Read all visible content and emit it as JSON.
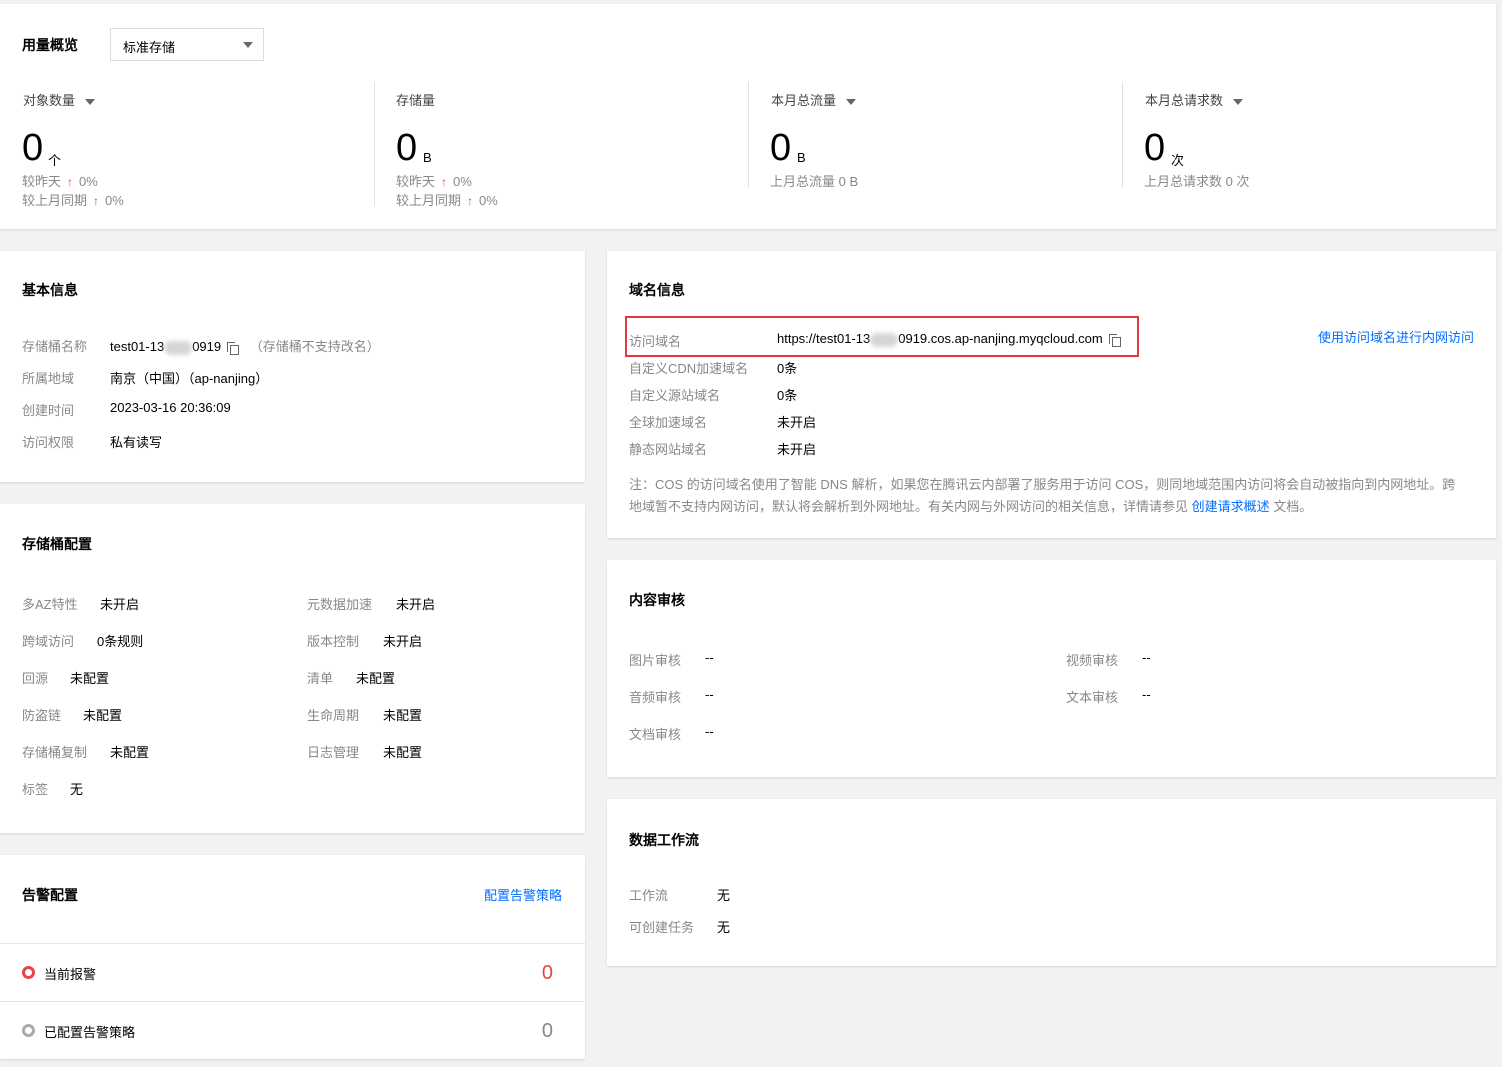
{
  "overview": {
    "title": "用量概览",
    "select_value": "标准存储",
    "stats": [
      {
        "label": "对象数量",
        "value": "0",
        "unit": "个",
        "dropdown": true,
        "lines": [
          {
            "text": "较昨天",
            "pct": "0%"
          },
          {
            "text": "较上月同期",
            "pct": "0%"
          }
        ]
      },
      {
        "label": "存储量",
        "value": "0",
        "unit": "B",
        "dropdown": false,
        "lines": [
          {
            "text": "较昨天",
            "pct": "0%"
          },
          {
            "text": "较上月同期",
            "pct": "0%"
          }
        ]
      },
      {
        "label": "本月总流量",
        "value": "0",
        "unit": "B",
        "dropdown": true,
        "sub": "上月总流量 0 B"
      },
      {
        "label": "本月总请求数",
        "value": "0",
        "unit": "次",
        "dropdown": true,
        "sub": "上月总请求数 0 次"
      }
    ],
    "up_arrow": "↑"
  },
  "basic": {
    "title": "基本信息",
    "name_label": "存储桶名称",
    "name_prefix": "test01-13",
    "name_suffix": "0919",
    "name_note": "（存储桶不支持改名）",
    "region_label": "所属地域",
    "region_value": "南京（中国）（ap-nanjing）",
    "created_label": "创建时间",
    "created_value": "2023-03-16 20:36:09",
    "acl_label": "访问权限",
    "acl_value": "私有读写"
  },
  "bucket_config": {
    "title": "存储桶配置",
    "left": [
      {
        "label": "多AZ特性",
        "value": "未开启"
      },
      {
        "label": "跨域访问",
        "value": "0条规则"
      },
      {
        "label": "回源",
        "value": "未配置"
      },
      {
        "label": "防盗链",
        "value": "未配置"
      },
      {
        "label": "存储桶复制",
        "value": "未配置"
      },
      {
        "label": "标签",
        "value": "无"
      }
    ],
    "right": [
      {
        "label": "元数据加速",
        "value": "未开启"
      },
      {
        "label": "版本控制",
        "value": "未开启"
      },
      {
        "label": "清单",
        "value": "未配置"
      },
      {
        "label": "生命周期",
        "value": "未配置"
      },
      {
        "label": "日志管理",
        "value": "未配置"
      }
    ]
  },
  "alarm": {
    "title": "告警配置",
    "config_link": "配置告警策略",
    "current_label": "当前报警",
    "current_value": "0",
    "configured_label": "已配置告警策略",
    "configured_value": "0",
    "alert_color": "#e54545"
  },
  "domain": {
    "title": "域名信息",
    "access_label": "访问域名",
    "access_prefix": "https://test01-13",
    "access_suffix": "0919.cos.ap-nanjing.myqcloud.com",
    "internal_link": "使用访问域名进行内网访问",
    "rows": [
      {
        "label": "自定义CDN加速域名",
        "value": "0条"
      },
      {
        "label": "自定义源站域名",
        "value": "0条"
      },
      {
        "label": "全球加速域名",
        "value": "未开启"
      },
      {
        "label": "静态网站域名",
        "value": "未开启"
      }
    ],
    "note_1": "注：COS 的访问域名使用了智能 DNS 解析，如果您在腾讯云内部署了服务用于访问 COS，则同地域范围内访问将会自动被指向到内网地址。跨",
    "note_2": "地域暂不支持内网访问，默认将会解析到外网地址。有关内网与外网访问的相关信息，详情请参见",
    "note_link": "创建请求概述",
    "note_tail": "文档。",
    "highlight_color": "#e0383e"
  },
  "audit": {
    "title": "内容审核",
    "items": [
      {
        "label": "图片审核",
        "value": "--"
      },
      {
        "label": "视频审核",
        "value": "--"
      },
      {
        "label": "音频审核",
        "value": "--"
      },
      {
        "label": "文本审核",
        "value": "--"
      },
      {
        "label": "文档审核",
        "value": "--"
      }
    ]
  },
  "workflow": {
    "title": "数据工作流",
    "workflow_label": "工作流",
    "workflow_value": "无",
    "task_label": "可创建任务",
    "task_value": "无"
  },
  "colors": {
    "accent": "#006eff",
    "up": "#e54545"
  }
}
